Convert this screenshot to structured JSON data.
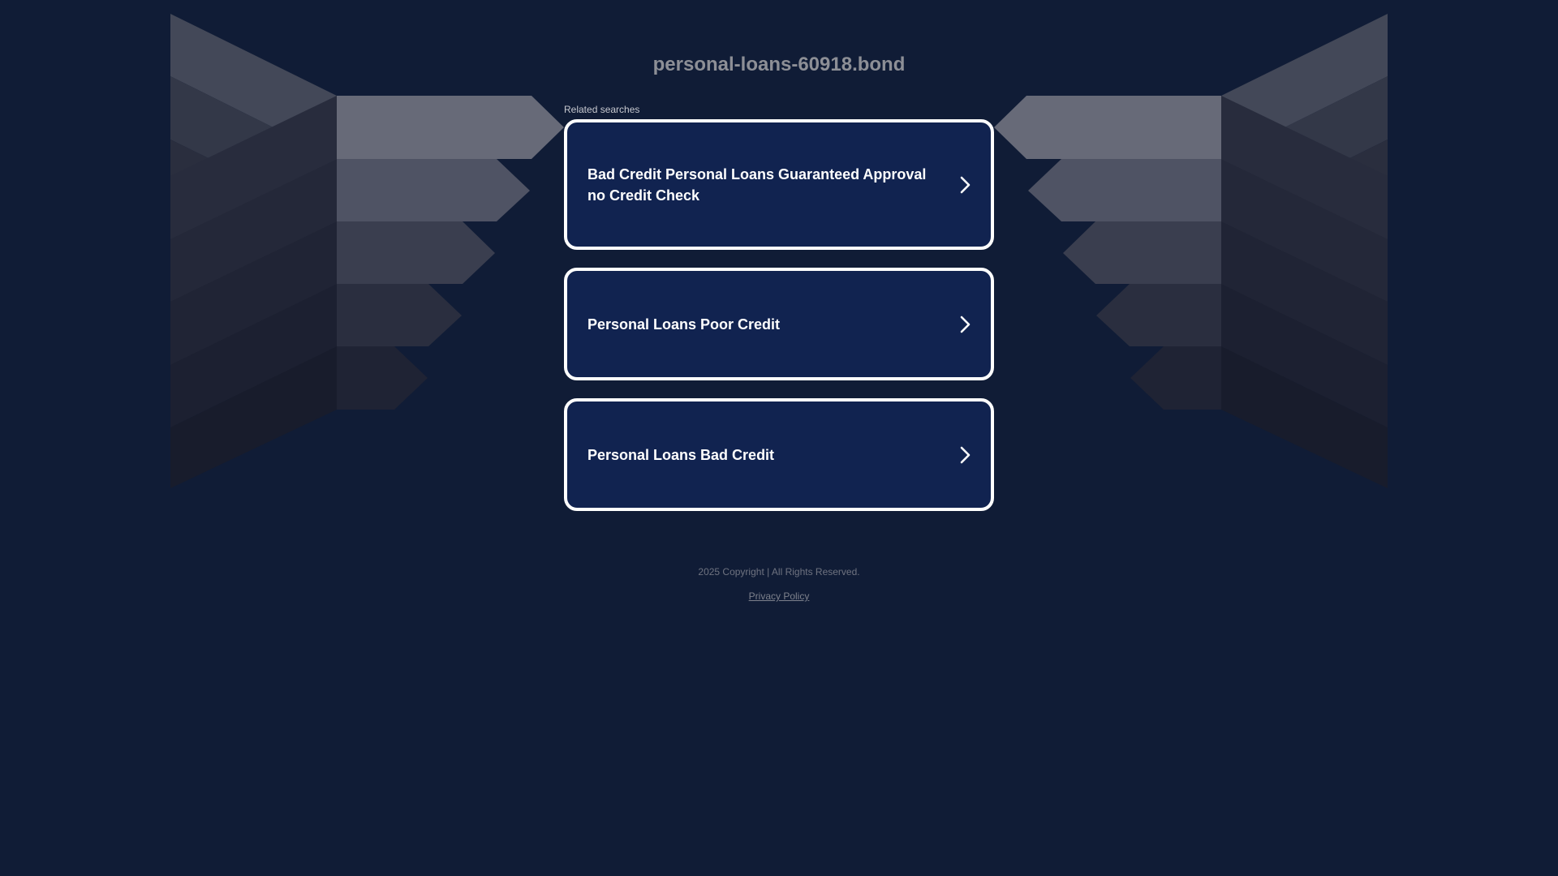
{
  "page": {
    "title": "personal-loans-60918.bond",
    "related_label": "Related searches"
  },
  "results": [
    {
      "label": "Bad Credit Personal Loans Guaranteed Approval no Credit Check",
      "icon": "chevron-right-icon"
    },
    {
      "label": "Personal Loans Poor Credit",
      "icon": "chevron-right-icon"
    },
    {
      "label": "Personal Loans Bad Credit",
      "icon": "chevron-right-icon"
    }
  ],
  "footer": {
    "copyright": "2025 Copyright | All Rights Reserved.",
    "privacy_label": "Privacy Policy"
  },
  "colors": {
    "background": "#101c36",
    "card_background": "#112350",
    "card_border": "#ffffff",
    "title_text": "#8d8f96",
    "wing_light": "#676a78",
    "wing_dark": "#1a1f30"
  }
}
